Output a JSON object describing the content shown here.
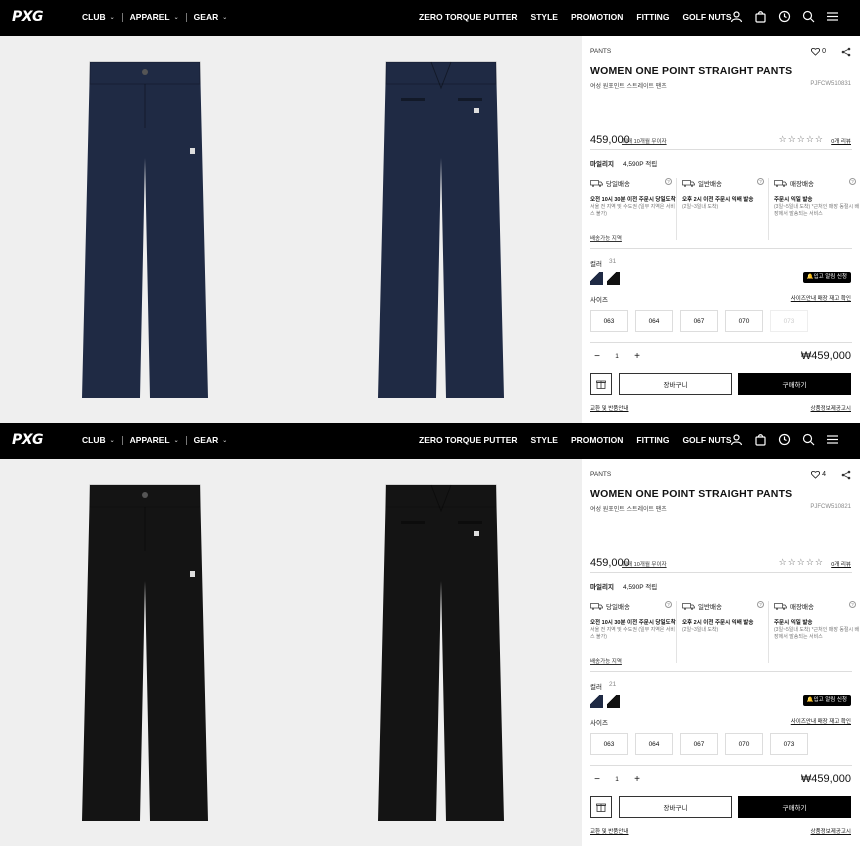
{
  "nav": {
    "logo": "PXG",
    "left_items": [
      "CLUB",
      "APPAREL",
      "GEAR"
    ],
    "right_items": [
      "ZERO TORQUE PUTTER",
      "STYLE",
      "PROMOTION",
      "FITTING",
      "GOLF NUTS"
    ],
    "icons": [
      "user-icon",
      "bag-icon",
      "history-icon",
      "search-icon",
      "menu-icon"
    ]
  },
  "panels": [
    {
      "category": "PANTS",
      "likes": "0",
      "title": "WOMEN ONE POINT STRAIGHT PANTS",
      "subtitle": "여성 원포인트 스트레이트 팬츠",
      "code": "PJFCW510831",
      "price": "459,000",
      "installment": "최대 10개월 무이자",
      "reviews": "0개 리뷰",
      "mileage_label": "마일리지",
      "mileage_value": "4,590P 적립",
      "shipping": [
        {
          "title": "당일배송",
          "bold": "오전 10시 30분 이전 주문시 당일도착",
          "small": "서울 전 지역 및 수도권 (일부 지역은 서비스 불가)"
        },
        {
          "title": "일반배송",
          "bold": "오후 2시 이전 주문시 익배 발송",
          "small": "(2일~3일내 도착)"
        },
        {
          "title": "매장배송",
          "bold": "주문시 익일 발송",
          "small": "(3일~5일내 도착) *근처인 매장 동절시 배장에서 발송되는 서비스"
        }
      ],
      "shipping_link": "배송가능 지역",
      "color_label": "컬러",
      "color_count": "31",
      "notify": "입고 알림 신청",
      "size_label": "사이즈",
      "size_links": "사이즈안내  매장 재고 확인",
      "sizes": [
        {
          "label": "063",
          "available": true
        },
        {
          "label": "064",
          "available": true
        },
        {
          "label": "067",
          "available": true
        },
        {
          "label": "070",
          "available": true
        },
        {
          "label": "073",
          "available": false
        }
      ],
      "qty": "1",
      "total": "₩459,000",
      "cart_label": "장바구니",
      "buy_label": "구매하기",
      "bottom_left": "교환 및 반품안내",
      "bottom_right": "상품정보제공고시",
      "product_color": "#1f2a44",
      "swatch_colors": [
        "#1f2a44",
        "#111111"
      ]
    },
    {
      "category": "PANTS",
      "likes": "4",
      "title": "WOMEN ONE POINT STRAIGHT PANTS",
      "subtitle": "여성 원포인트 스트레이트 팬츠",
      "code": "PJFCW510821",
      "price": "459,000",
      "installment": "최대 10개월 무이자",
      "reviews": "0개 리뷰",
      "mileage_label": "마일리지",
      "mileage_value": "4,590P 적립",
      "shipping": [
        {
          "title": "당일배송",
          "bold": "오전 10시 30분 이전 주문시 당일도착",
          "small": "서울 전 지역 및 수도권 (일부 지역은 서비스 불가)"
        },
        {
          "title": "일반배송",
          "bold": "오후 2시 이전 주문시 익배 발송",
          "small": "(2일~3일내 도착)"
        },
        {
          "title": "매장배송",
          "bold": "주문시 익일 발송",
          "small": "(3일~5일내 도착) *근처인 매장 동절시 배장에서 발송되는 서비스"
        }
      ],
      "shipping_link": "배송가능 지역",
      "color_label": "컬러",
      "color_count": "21",
      "notify": "입고 알림 신청",
      "size_label": "사이즈",
      "size_links": "사이즈안내  매장 재고 확인",
      "sizes": [
        {
          "label": "063",
          "available": true
        },
        {
          "label": "064",
          "available": true
        },
        {
          "label": "067",
          "available": true
        },
        {
          "label": "070",
          "available": true
        },
        {
          "label": "073",
          "available": true
        }
      ],
      "qty": "1",
      "total": "₩459,000",
      "cart_label": "장바구니",
      "buy_label": "구매하기",
      "bottom_left": "교환 및 반품안내",
      "bottom_right": "상품정보제공고시",
      "product_color": "#141414",
      "swatch_colors": [
        "#1f2a44",
        "#111111"
      ]
    }
  ]
}
